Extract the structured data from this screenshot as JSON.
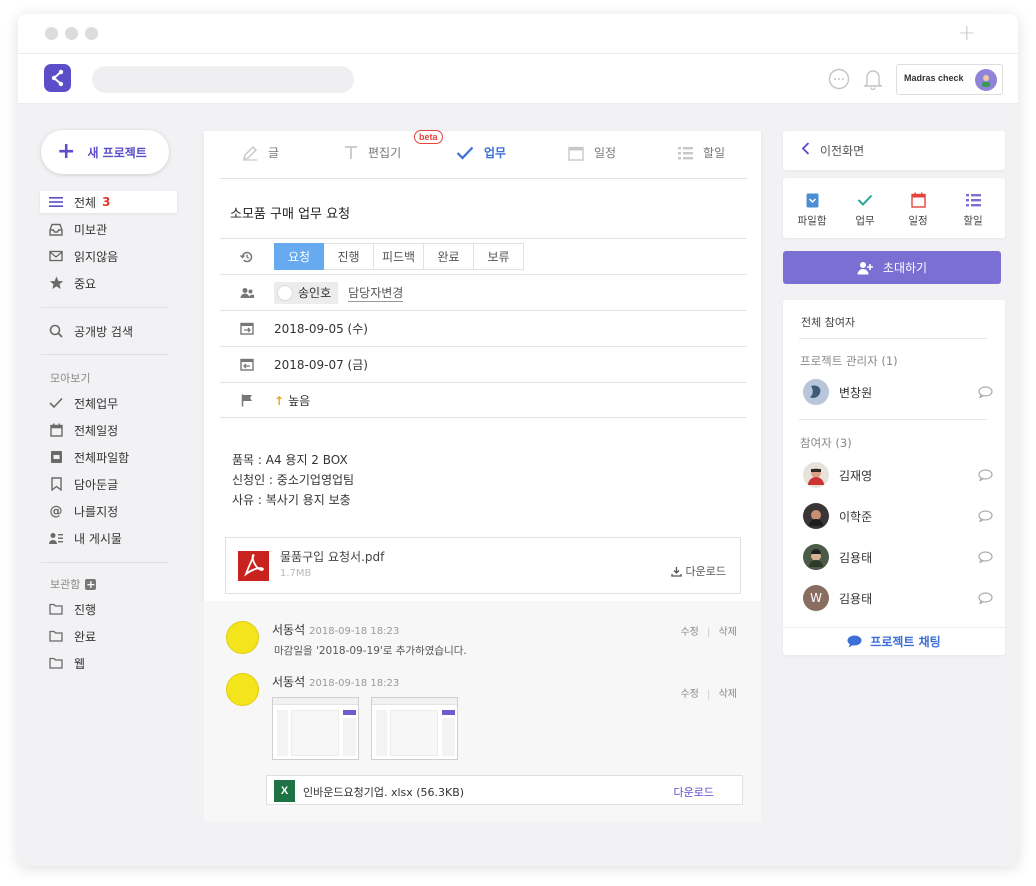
{
  "header": {
    "brand": "Madras check"
  },
  "sidebar": {
    "new_project": "새 프로젝트",
    "items": [
      {
        "label": "전체",
        "count": "3"
      },
      {
        "label": "미보관"
      },
      {
        "label": "읽지않음"
      },
      {
        "label": "중요"
      }
    ],
    "public_search": "공개방 검색",
    "collect_label": "모아보기",
    "collect_items": [
      "전체업무",
      "전체일정",
      "전체파일함",
      "담아둔글",
      "나를지정",
      "내 게시물"
    ],
    "archive_label": "보관함",
    "archive_items": [
      "진행",
      "완료",
      "웹"
    ]
  },
  "tabs": [
    {
      "label": "글",
      "icon": "pencil-icon"
    },
    {
      "label": "편집기",
      "icon": "text-icon",
      "badge": "beta"
    },
    {
      "label": "업무",
      "icon": "check-icon",
      "active": true
    },
    {
      "label": "일정",
      "icon": "calendar-icon"
    },
    {
      "label": "할일",
      "icon": "list-icon"
    }
  ],
  "task": {
    "title": "소모품 구매 업무 요청",
    "statuses": [
      "요청",
      "진행",
      "피드백",
      "완료",
      "보류"
    ],
    "active_status": "요청",
    "assignee": "송인호",
    "change_assignee": "담당자변경",
    "start_date": "2018-09-05 (수)",
    "end_date": "2018-09-07 (금)",
    "priority": "높음",
    "body": [
      "품목 : A4 용지 2 BOX",
      "신청인 : 중소기업영업팀",
      "사유 : 복사기 용지 보충"
    ],
    "attachment": {
      "name": "물품구입 요청서.pdf",
      "size": "1.7MB",
      "download": "다운로드"
    }
  },
  "comments": [
    {
      "author": "서동석",
      "time": "2018-09-18 18:23",
      "edit": "수정",
      "delete": "삭제",
      "text": "마감일을 '2018-09-19'로 추가하였습니다."
    },
    {
      "author": "서동석",
      "time": "2018-09-18 18:23",
      "edit": "수정",
      "delete": "삭제",
      "file": "인바운드요청기업. xlsx (56.3KB)",
      "download": "다운로드"
    }
  ],
  "right": {
    "back": "이전화면",
    "quick": [
      {
        "label": "파일함",
        "icon": "file-box-icon",
        "color": "#4a8fd6"
      },
      {
        "label": "업무",
        "icon": "check-icon",
        "color": "#22a695"
      },
      {
        "label": "일정",
        "icon": "calendar-icon",
        "color": "#e5433c"
      },
      {
        "label": "할일",
        "icon": "list-icon",
        "color": "#7b6fd3"
      }
    ],
    "invite": "초대하기",
    "all_members": "전체 참여자",
    "managers_label": "프로젝트 관리자 (1)",
    "managers": [
      "변창원"
    ],
    "participants_label": "참여자 (3)",
    "participants": [
      "김재영",
      "이학준",
      "김용태",
      "김용태"
    ],
    "chat": "프로젝트 채팅"
  },
  "colors": {
    "accent": "#5b4ec8",
    "active_blue": "#3c6fd8",
    "status_active": "#67aaf0",
    "danger": "#e0382e"
  }
}
